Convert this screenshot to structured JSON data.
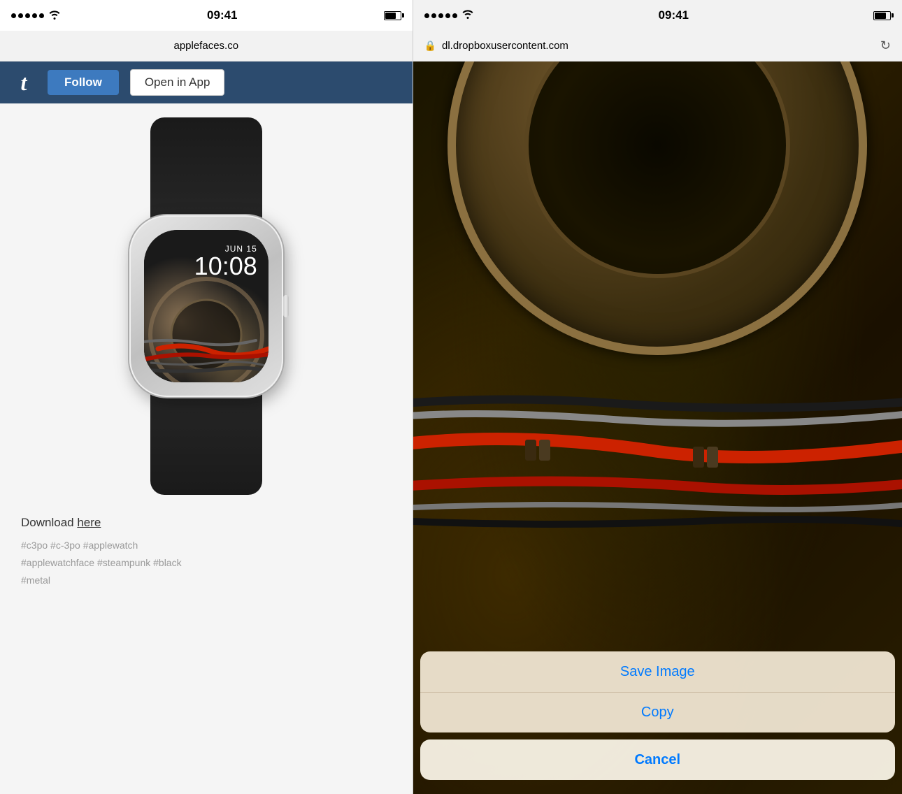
{
  "left": {
    "status_bar": {
      "time": "09:41",
      "url": "applefaces.co"
    },
    "header": {
      "follow_label": "Follow",
      "open_in_app_label": "Open in App"
    },
    "watch": {
      "date": "JUN 15",
      "time": "10:08"
    },
    "download": {
      "text": "Download ",
      "link_text": "here"
    },
    "tags": "#c3po  #c-3po  #applewatch\n#applewatchface  #steampunk  #black\n#metal"
  },
  "right": {
    "status_bar": {
      "time": "09:41"
    },
    "url_bar": {
      "url": "dl.dropboxusercontent.com"
    },
    "action_sheet": {
      "save_image_label": "Save Image",
      "copy_label": "Copy",
      "cancel_label": "Cancel"
    }
  },
  "icons": {
    "lock": "🔒",
    "reload": "↻",
    "wifi": "📶",
    "tumblr_t": "t"
  }
}
